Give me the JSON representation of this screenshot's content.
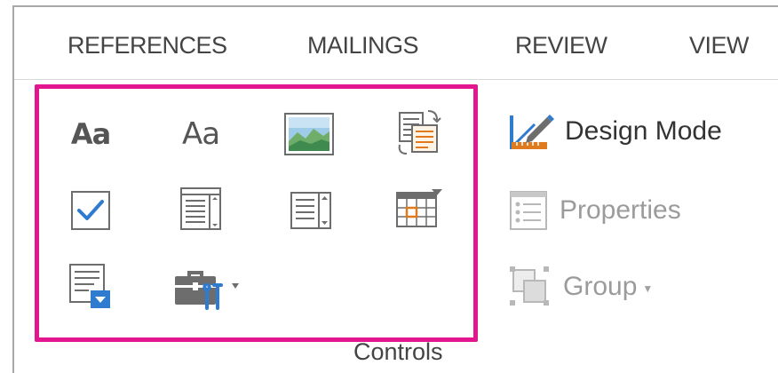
{
  "ribbon": {
    "tabs": [
      {
        "label": "REFERENCES"
      },
      {
        "label": "MAILINGS"
      },
      {
        "label": "REVIEW"
      },
      {
        "label": "VIEW"
      }
    ]
  },
  "controls_group": {
    "label": "Controls",
    "highlight_color": "#e2168f",
    "controls": [
      {
        "name": "rich-text-content-control",
        "icon": "Aa-bold-text",
        "text": "Aa"
      },
      {
        "name": "plain-text-content-control",
        "icon": "Aa-plain-text",
        "text": "Aa"
      },
      {
        "name": "picture-content-control",
        "icon": "picture-icon"
      },
      {
        "name": "building-block-gallery-content-control",
        "icon": "building-block-icon"
      },
      {
        "name": "check-box-content-control",
        "icon": "checkbox-icon"
      },
      {
        "name": "combo-box-content-control",
        "icon": "combo-box-icon"
      },
      {
        "name": "drop-down-list-content-control",
        "icon": "drop-down-list-icon"
      },
      {
        "name": "date-picker-content-control",
        "icon": "date-picker-icon"
      },
      {
        "name": "repeating-section-content-control",
        "icon": "repeating-section-icon"
      },
      {
        "name": "legacy-tools",
        "icon": "toolbox-icon"
      }
    ],
    "design_mode": {
      "label": "Design Mode",
      "icon": "design-mode-icon"
    },
    "properties": {
      "label": "Properties",
      "icon": "properties-icon",
      "enabled": false
    },
    "group": {
      "label": "Group",
      "icon": "group-icon",
      "enabled": false
    }
  }
}
